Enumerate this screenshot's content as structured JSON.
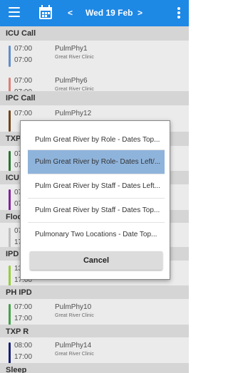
{
  "header": {
    "prev": "<",
    "date": "Wed 19 Feb",
    "next": ">"
  },
  "sections": [
    {
      "title": "ICU Call"
    },
    {
      "title": "IPC Call"
    },
    {
      "title": "TXP"
    },
    {
      "title": "ICU"
    },
    {
      "title": "Floor"
    },
    {
      "title": "IPD C"
    },
    {
      "title": "PH IPD"
    },
    {
      "title": "TXP R"
    },
    {
      "title": "Sleep"
    }
  ],
  "rows": [
    {
      "start": "07:00",
      "end": "07:00",
      "name": "PulmPhy1",
      "place": "Great River Clinic",
      "color": "#6a9be0"
    },
    {
      "start": "07:00",
      "end": "07:00",
      "name": "PulmPhy6",
      "place": "Great River Clinic",
      "color": "#f08a80"
    },
    {
      "start": "07:00",
      "end": "",
      "name": "PulmPhy12",
      "place": "",
      "color": "#7a4a1a"
    },
    {
      "start": "07",
      "end": "07",
      "name": "",
      "place": "",
      "color": "#2e7d32"
    },
    {
      "start": "07",
      "end": "07",
      "name": "",
      "place": "",
      "color": "#8e24aa"
    },
    {
      "start": "07",
      "end": "17",
      "name": "",
      "place": "",
      "color": "#cfcfcf"
    },
    {
      "start": "13",
      "end": "17:00",
      "name": "",
      "place": "",
      "color": "#a4e042"
    },
    {
      "start": "07:00",
      "end": "17:00",
      "name": "PulmPhy10",
      "place": "Great River Clinic",
      "color": "#4caf50"
    },
    {
      "start": "08:00",
      "end": "17:00",
      "name": "PulmPhy14",
      "place": "Great River Clinic",
      "color": "#1a237e"
    }
  ],
  "dialog": {
    "options": [
      "Pulm Great River by Role - Dates Top...",
      "Pulm Great River by Role- Dates Left/...",
      "Pulm Great River by Staff - Dates Left...",
      "Pulm Great River by Staff - Dates Top...",
      "Pulmonary Two Locations - Date Top..."
    ],
    "selected_index": 1,
    "cancel_label": "Cancel"
  }
}
